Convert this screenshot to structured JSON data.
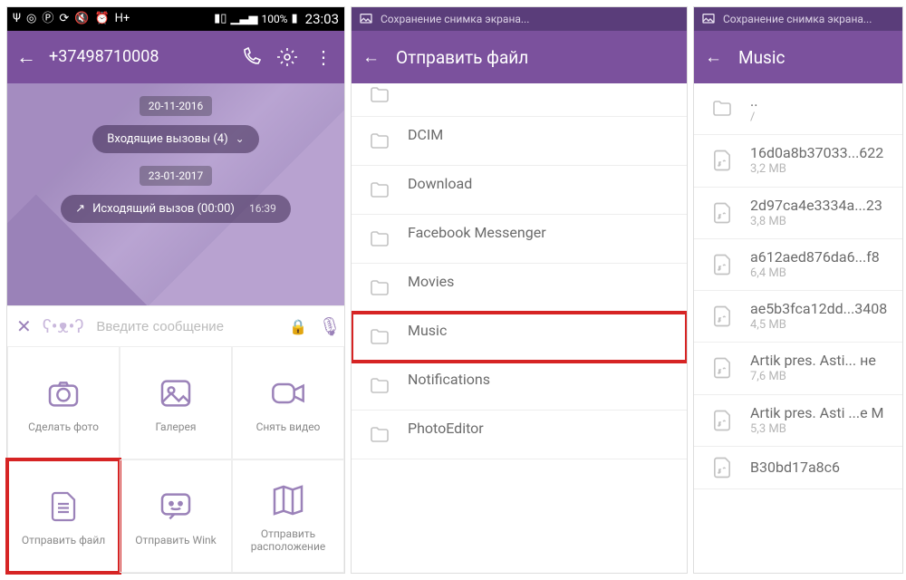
{
  "colors": {
    "accent": "#7b519d",
    "highlight": "#d62424"
  },
  "phone1": {
    "statusbar": {
      "signal_label": "H+",
      "battery_pct": "100%",
      "time": "23:03"
    },
    "header": {
      "number": "+37498710008"
    },
    "chat": {
      "date1": "20-11-2016",
      "incoming_label": "Входящие вызовы  (4)",
      "date2": "23-01-2017",
      "outgoing_label": "Исходящий вызов  (00:00)",
      "outgoing_time": "16:39"
    },
    "composer": {
      "placeholder": "Введите сообщение"
    },
    "grid": {
      "photo": "Сделать фото",
      "gallery": "Галерея",
      "video": "Снять видео",
      "send_file": "Отправить файл",
      "send_wink": "Отправить Wink",
      "send_location": "Отправить расположение"
    }
  },
  "phone2": {
    "statusbar": {
      "saving": "Сохранение снимка экрана..."
    },
    "header": {
      "title": "Отправить файл"
    },
    "rows": [
      {
        "name": "",
        "sub": "<DIR>",
        "partial": true
      },
      {
        "name": "DCIM",
        "sub": "<DIR>"
      },
      {
        "name": "Download",
        "sub": "<DIR>"
      },
      {
        "name": "Facebook Messenger",
        "sub": "<DIR>"
      },
      {
        "name": "Movies",
        "sub": "<DIR>"
      },
      {
        "name": "Music",
        "sub": "<DIR>",
        "highlight": true
      },
      {
        "name": "Notifications",
        "sub": "<DIR>"
      },
      {
        "name": "PhotoEditor",
        "sub": "<DIR>"
      }
    ]
  },
  "phone3": {
    "statusbar": {
      "saving": "Сохранение снимка экрана..."
    },
    "header": {
      "title": "Music"
    },
    "up": {
      "name": "..",
      "sub": "/"
    },
    "rows": [
      {
        "name": "16d0a8b37033...622",
        "sub": "3,2 MB"
      },
      {
        "name": "2d97ca4e3334a...23",
        "sub": "3,8 MB"
      },
      {
        "name": "a612aed876da6...f8",
        "sub": "6,4 MB"
      },
      {
        "name": "ae5b3fca12dd...3408",
        "sub": "4,5 MB"
      },
      {
        "name": "Artik pres. Asti... не",
        "sub": "7,6 MB"
      },
      {
        "name": "Artik pres. Asti ...e M",
        "sub": "5,3 MB"
      },
      {
        "name": "B30bd17a8c6 ",
        "sub": ""
      }
    ]
  }
}
